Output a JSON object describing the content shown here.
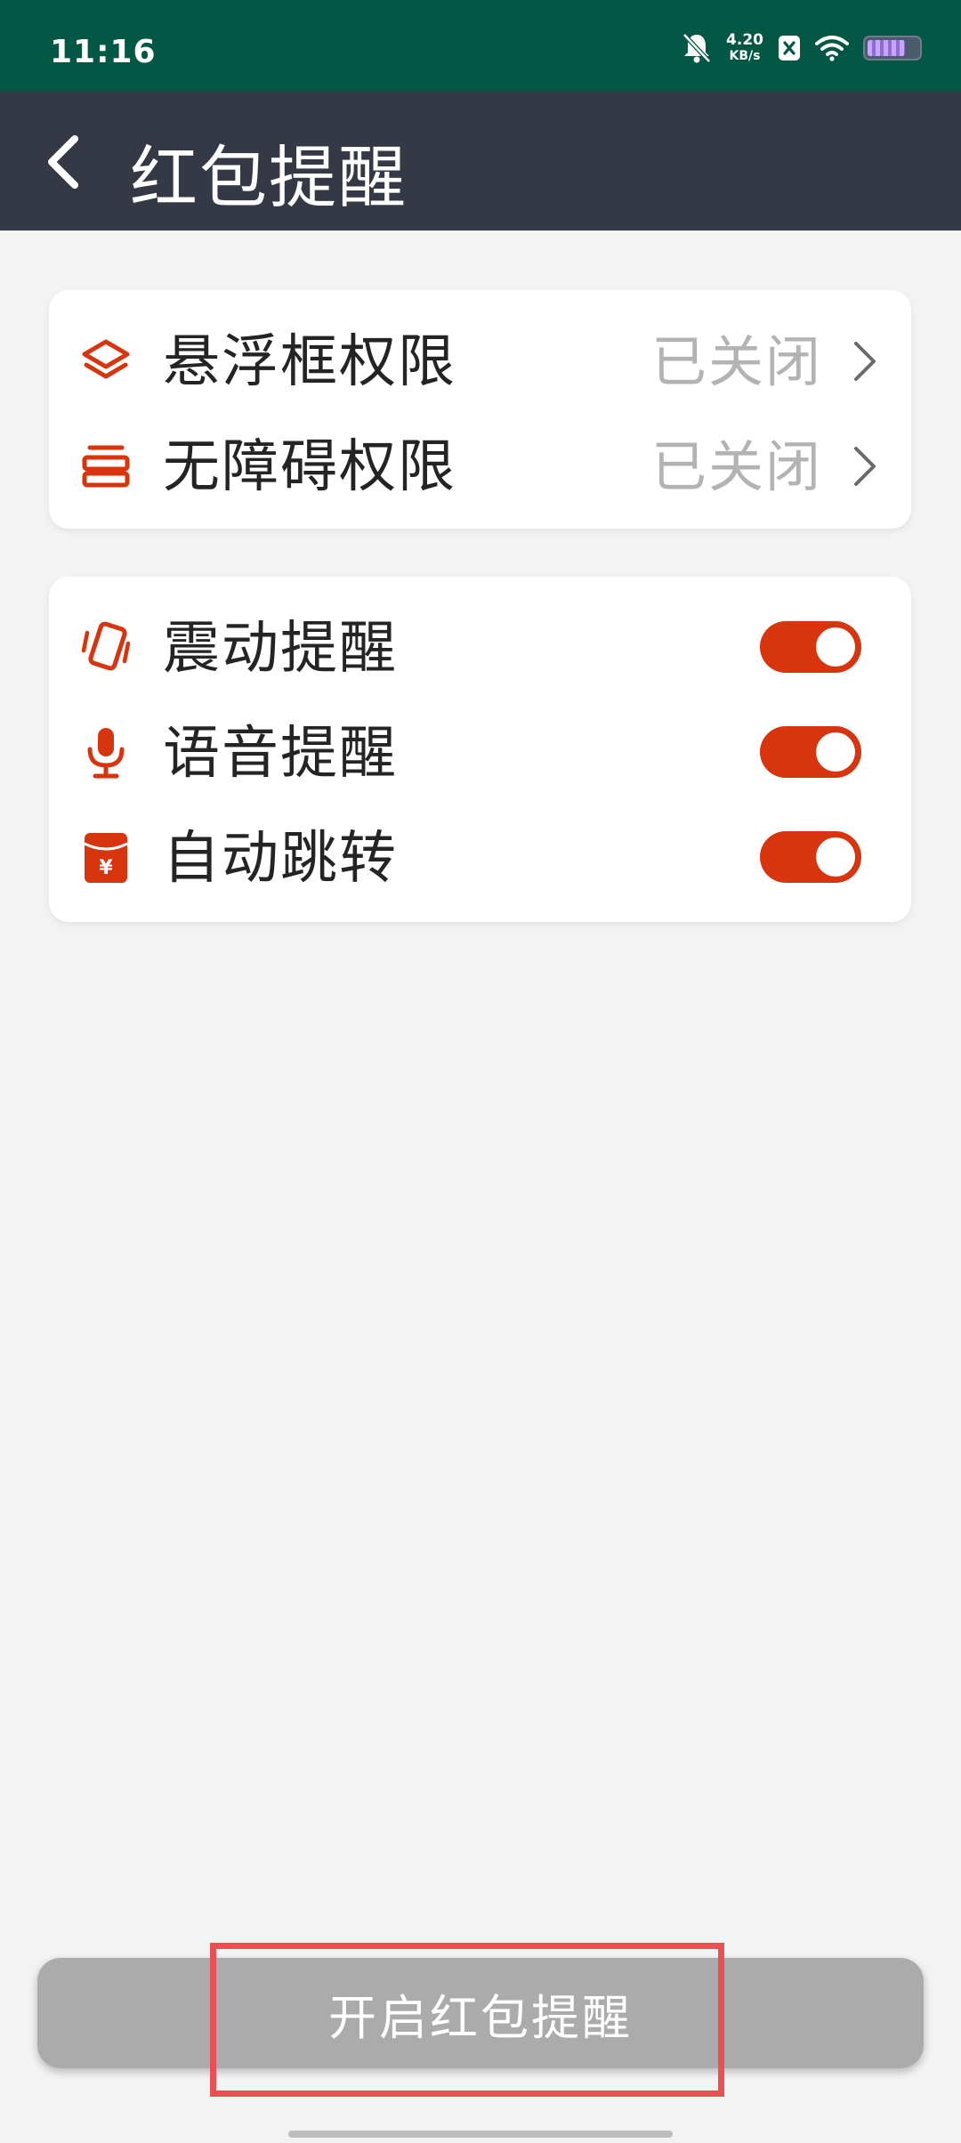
{
  "status_bar": {
    "time": "11:16",
    "net_speed_value": "4.20",
    "net_speed_unit": "KB/s",
    "icons": [
      "bell-muted-icon",
      "close-box-icon",
      "wifi-icon",
      "battery-icon"
    ],
    "background": "#025745"
  },
  "header": {
    "title": "红包提醒",
    "back_icon": "chevron-left-icon",
    "background": "#343945"
  },
  "permissions": [
    {
      "icon": "layers-icon",
      "label": "悬浮框权限",
      "value": "已关闭"
    },
    {
      "icon": "accessibility-icon",
      "label": "无障碍权限",
      "value": "已关闭"
    }
  ],
  "settings": [
    {
      "icon": "vibrate-phone-icon",
      "label": "震动提醒",
      "enabled": true
    },
    {
      "icon": "microphone-icon",
      "label": "语音提醒",
      "enabled": true
    },
    {
      "icon": "red-envelope-icon",
      "label": "自动跳转",
      "enabled": true
    }
  ],
  "action_button": {
    "label": "开启红包提醒"
  },
  "colors": {
    "accent": "#d8340d",
    "disabled_button": "#ababab",
    "highlight": "#e85152"
  }
}
